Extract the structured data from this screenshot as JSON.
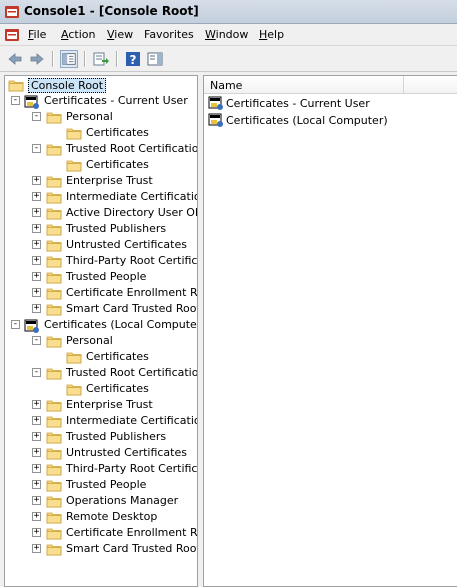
{
  "window": {
    "title": "Console1 - [Console Root]"
  },
  "menu": [
    {
      "label": "File",
      "ul": "F",
      "rest": "ile"
    },
    {
      "label": "Action",
      "ul": "A",
      "rest": "ction"
    },
    {
      "label": "View",
      "ul": "V",
      "rest": "iew"
    },
    {
      "label": "Favorites",
      "ul": "",
      "rest": "Favorites"
    },
    {
      "label": "Window",
      "ul": "W",
      "rest": "indow"
    },
    {
      "label": "Help",
      "ul": "H",
      "rest": "elp"
    }
  ],
  "toolbar": [
    "back-icon",
    "forward-icon",
    "show-hide-tree-icon",
    "export-list-icon",
    "help-icon",
    "action-pane-icon"
  ],
  "tree": [
    {
      "label": "Console Root",
      "level": 0,
      "exp": "",
      "icon": "folder",
      "selected": true
    },
    {
      "label": "Certificates - Current User",
      "level": 0,
      "exp": "−",
      "icon": "cert"
    },
    {
      "label": "Personal",
      "level": 1,
      "exp": "−",
      "icon": "folder"
    },
    {
      "label": "Certificates",
      "level": 2,
      "exp": "",
      "icon": "folder"
    },
    {
      "label": "Trusted Root Certification Authorities",
      "level": 1,
      "exp": "−",
      "icon": "folder"
    },
    {
      "label": "Certificates",
      "level": 2,
      "exp": "",
      "icon": "folder"
    },
    {
      "label": "Enterprise Trust",
      "level": 1,
      "exp": "+",
      "icon": "folder"
    },
    {
      "label": "Intermediate Certification Authorities",
      "level": 1,
      "exp": "+",
      "icon": "folder"
    },
    {
      "label": "Active Directory User Object",
      "level": 1,
      "exp": "+",
      "icon": "folder"
    },
    {
      "label": "Trusted Publishers",
      "level": 1,
      "exp": "+",
      "icon": "folder"
    },
    {
      "label": "Untrusted Certificates",
      "level": 1,
      "exp": "+",
      "icon": "folder"
    },
    {
      "label": "Third-Party Root Certification Authorities",
      "level": 1,
      "exp": "+",
      "icon": "folder"
    },
    {
      "label": "Trusted People",
      "level": 1,
      "exp": "+",
      "icon": "folder"
    },
    {
      "label": "Certificate Enrollment Requests",
      "level": 1,
      "exp": "+",
      "icon": "folder"
    },
    {
      "label": "Smart Card Trusted Roots",
      "level": 1,
      "exp": "+",
      "icon": "folder"
    },
    {
      "label": "Certificates (Local Computer)",
      "level": 0,
      "exp": "−",
      "icon": "cert"
    },
    {
      "label": "Personal",
      "level": 1,
      "exp": "−",
      "icon": "folder"
    },
    {
      "label": "Certificates",
      "level": 2,
      "exp": "",
      "icon": "folder"
    },
    {
      "label": "Trusted Root Certification Authorities",
      "level": 1,
      "exp": "−",
      "icon": "folder"
    },
    {
      "label": "Certificates",
      "level": 2,
      "exp": "",
      "icon": "folder"
    },
    {
      "label": "Enterprise Trust",
      "level": 1,
      "exp": "+",
      "icon": "folder"
    },
    {
      "label": "Intermediate Certification Authorities",
      "level": 1,
      "exp": "+",
      "icon": "folder"
    },
    {
      "label": "Trusted Publishers",
      "level": 1,
      "exp": "+",
      "icon": "folder"
    },
    {
      "label": "Untrusted Certificates",
      "level": 1,
      "exp": "+",
      "icon": "folder"
    },
    {
      "label": "Third-Party Root Certification Authorities",
      "level": 1,
      "exp": "+",
      "icon": "folder"
    },
    {
      "label": "Trusted People",
      "level": 1,
      "exp": "+",
      "icon": "folder"
    },
    {
      "label": "Operations Manager",
      "level": 1,
      "exp": "+",
      "icon": "folder"
    },
    {
      "label": "Remote Desktop",
      "level": 1,
      "exp": "+",
      "icon": "folder"
    },
    {
      "label": "Certificate Enrollment Requests",
      "level": 1,
      "exp": "+",
      "icon": "folder"
    },
    {
      "label": "Smart Card Trusted Roots",
      "level": 1,
      "exp": "+",
      "icon": "folder"
    }
  ],
  "list": {
    "header": "Name",
    "items": [
      "Certificates - Current User",
      "Certificates (Local Computer)"
    ]
  }
}
